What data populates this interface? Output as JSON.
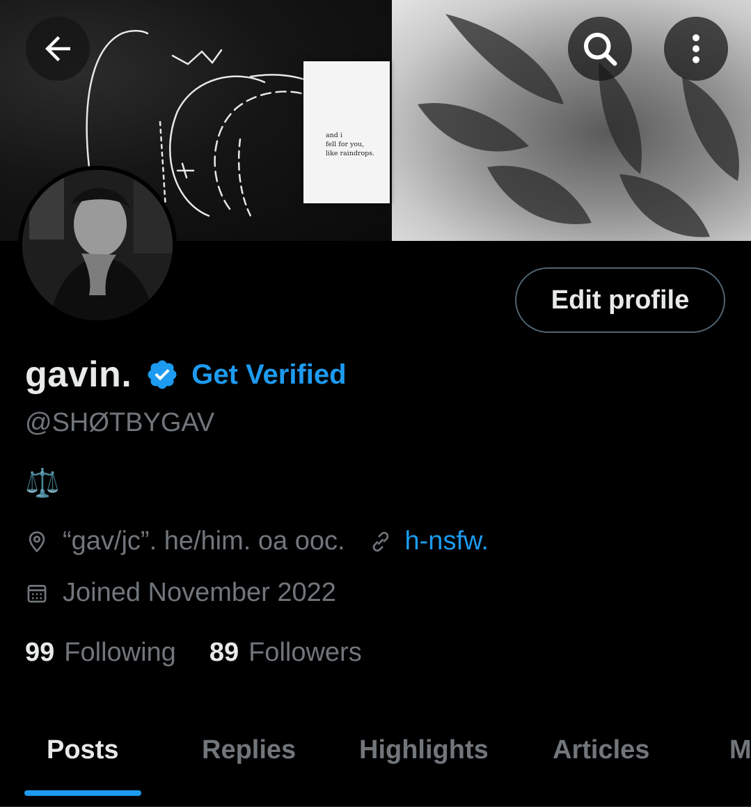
{
  "header": {
    "back_icon": "arrow-left-icon",
    "search_icon": "search-icon",
    "more_icon": "more-vertical-icon"
  },
  "banner": {
    "quote": "and i\nfell for you,\nlike raindrops."
  },
  "profile": {
    "edit_label": "Edit profile",
    "display_name": "gavin.",
    "verified_icon": "verified-badge-icon",
    "get_verified_label": "Get Verified",
    "handle": "@SHØTBYGAV",
    "bio": "⚖️",
    "location": "“gav/jc”. he/him. oa ooc.",
    "link_text": "h-nsfw.",
    "joined": "Joined November 2022",
    "following_count": "99",
    "following_label": "Following",
    "followers_count": "89",
    "followers_label": "Followers"
  },
  "tabs": [
    {
      "label": "Posts",
      "active": true
    },
    {
      "label": "Replies",
      "active": false
    },
    {
      "label": "Highlights",
      "active": false
    },
    {
      "label": "Articles",
      "active": false
    },
    {
      "label": "M",
      "active": false
    }
  ],
  "colors": {
    "accent": "#1d9bf0",
    "text_primary": "#e7e9ea",
    "text_secondary": "#71767b",
    "background": "#000000"
  }
}
